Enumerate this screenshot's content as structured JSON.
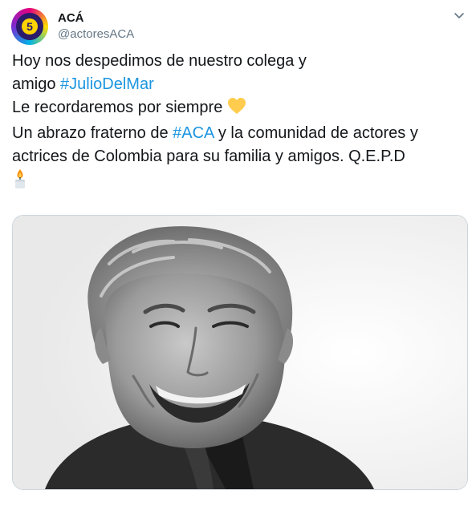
{
  "account": {
    "display_name": "ACÁ",
    "handle": "@actoresACA",
    "avatar_badge": "5"
  },
  "tweet": {
    "line1": "Hoy nos despedimos de nuestro colega y",
    "line2_prefix": "amigo ",
    "line2_hashtag": "#JulioDelMar",
    "line3": "Le recordaremos por siempre",
    "line4_prefix": "Un abrazo fraterno de ",
    "line4_hashtag": "#ACA",
    "line4_suffix": " y la comunidad de actores y",
    "line5": "actrices de Colombia para su familia y amigos. Q.E.P.D"
  },
  "icons": {
    "heart": "yellow-heart-icon",
    "candle": "candle-icon",
    "menu": "chevron-down-icon"
  },
  "colors": {
    "hashtag": "#1b95e0",
    "handle": "#657786",
    "text": "#14171a",
    "heart": "#ffcc4d"
  }
}
